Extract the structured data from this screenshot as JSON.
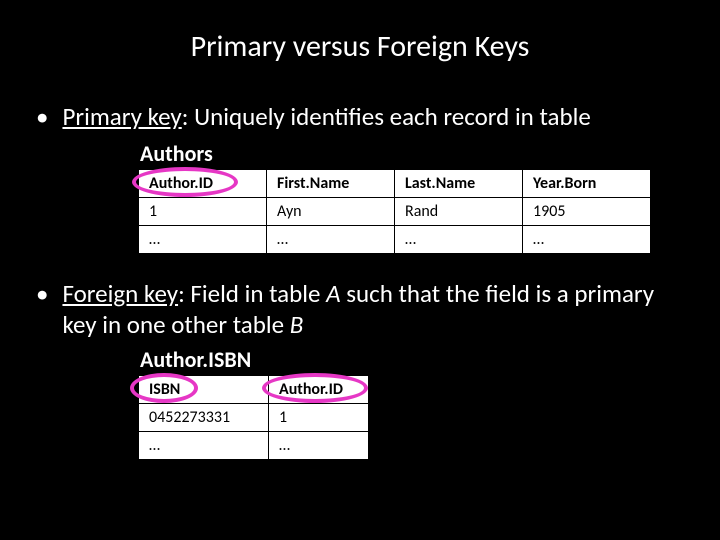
{
  "title": "Primary versus Foreign Keys",
  "bullet1": {
    "lead": "Primary key",
    "rest": ": Uniquely identifies each record in table"
  },
  "authors": {
    "label": "Authors",
    "headers": {
      "c1": "Author.ID",
      "c2": "First.Name",
      "c3": "Last.Name",
      "c4": "Year.Born"
    },
    "row1": {
      "c1": "1",
      "c2": "Ayn",
      "c3": "Rand",
      "c4": "1905"
    },
    "row2": {
      "c1": "…",
      "c2": "…",
      "c3": "…",
      "c4": "…"
    }
  },
  "bullet2": {
    "lead": "Foreign key",
    "mid1": ": Field in table ",
    "a": "A",
    "mid2": " such that the field is a primary key in one other table ",
    "b": "B"
  },
  "isbn": {
    "label": "Author.ISBN",
    "headers": {
      "c1": "ISBN",
      "c2": "Author.ID"
    },
    "row1": {
      "c1": "0452273331",
      "c2": "1"
    },
    "row2": {
      "c1": "…",
      "c2": "…"
    }
  }
}
